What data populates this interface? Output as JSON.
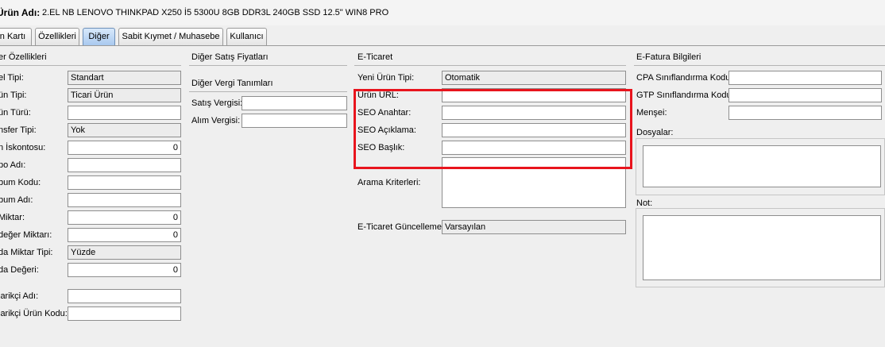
{
  "header": {
    "label": "Ürün Adı:",
    "value": "2.EL NB LENOVO THINKPAD X250 İ5 5300U 8GB DDR3L 240GB SSD 12.5\" WIN8 PRO"
  },
  "tabs": [
    {
      "label": "n Kartı",
      "active": false
    },
    {
      "label": "Özellikleri",
      "active": false
    },
    {
      "label": "Diğer",
      "active": true
    },
    {
      "label": "Sabit Kıymet / Muhasebe",
      "active": false
    },
    {
      "label": "Kullanıcı",
      "active": false
    }
  ],
  "left": {
    "title": "er Özellikleri",
    "rows": [
      {
        "label": "el Tipi:",
        "value": "Standart"
      },
      {
        "label": "ün Tipi:",
        "value": "Ticari Ürün"
      },
      {
        "label": "ün Türü:",
        "value": ""
      },
      {
        "label": "nsfer Tipi:",
        "value": "Yok"
      },
      {
        "label": "n İskontosu:",
        "value": "0"
      },
      {
        "label": "po Adı:",
        "value": ""
      },
      {
        "label": "bum Kodu:",
        "value": ""
      },
      {
        "label": "bum Adı:",
        "value": ""
      },
      {
        "label": "Miktar:",
        "value": "0"
      },
      {
        "label": "değer Miktarı:",
        "value": "0"
      },
      {
        "label": "da Miktar Tipi:",
        "value": "Yüzde"
      },
      {
        "label": "da Değeri:",
        "value": "0"
      },
      {
        "label": "larikçi Adı:",
        "value": ""
      },
      {
        "label": "larikçi Ürün Kodu:",
        "value": ""
      }
    ]
  },
  "mid": {
    "title": "Diğer Satış Fiyatları",
    "tax_title": "Diğer Vergi Tanımları",
    "rows": [
      {
        "label": "Satış Vergisi:",
        "value": ""
      },
      {
        "label": "Alım Vergisi:",
        "value": ""
      }
    ]
  },
  "ecom": {
    "title": "E-Ticaret",
    "rows": [
      {
        "label": "Yeni Ürün Tipi:",
        "value": "Otomatik"
      },
      {
        "label": "Ürün URL:",
        "value": ""
      },
      {
        "label": "SEO Anahtar:",
        "value": ""
      },
      {
        "label": "SEO Açıklama:",
        "value": ""
      },
      {
        "label": "SEO Başlık:",
        "value": ""
      }
    ],
    "search_label": "Arama Kriterleri:",
    "update_label": "E-Ticaret Güncelleme:",
    "update_value": "Varsayılan"
  },
  "efatura": {
    "title": "E-Fatura Bilgileri",
    "rows": [
      {
        "label": "CPA Sınıflandırma Kodu:",
        "value": ""
      },
      {
        "label": "GTP Sınıflandırma Kodu:",
        "value": ""
      },
      {
        "label": "Menşei:",
        "value": ""
      }
    ],
    "files_label": "Dosyalar:",
    "note_label": "Not:"
  },
  "colors": {
    "highlight": "#e8141d",
    "active_tab": "#a9c9ef"
  }
}
